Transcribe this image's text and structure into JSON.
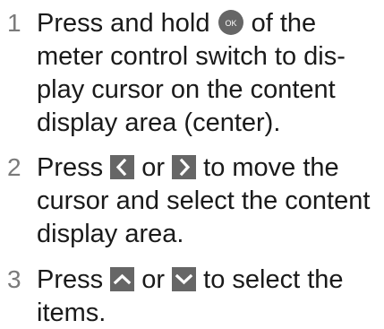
{
  "steps": [
    {
      "number": "1",
      "lines": [
        {
          "before": "Press and hold ",
          "after": " of the"
        },
        "meter control switch to dis-",
        "play cursor on the content",
        "display area (center)."
      ],
      "icons": [
        "ok-button-icon"
      ],
      "ok_label": "OK"
    },
    {
      "number": "2",
      "lines": [
        {
          "before": "Press ",
          "middle": " or ",
          "after": " to move the"
        },
        "cursor and select the content",
        "display area."
      ],
      "icons": [
        "left-arrow-button-icon",
        "right-arrow-button-icon"
      ]
    },
    {
      "number": "3",
      "lines": [
        {
          "before": "Press ",
          "middle": " or ",
          "after": " to select the"
        },
        "items."
      ],
      "icons": [
        "up-arrow-button-icon",
        "down-arrow-button-icon"
      ]
    }
  ],
  "colors": {
    "text": "#1a1a1a",
    "step_number": "#7a7a7a",
    "icon_bg": "#666666",
    "icon_fg": "#ffffff"
  }
}
